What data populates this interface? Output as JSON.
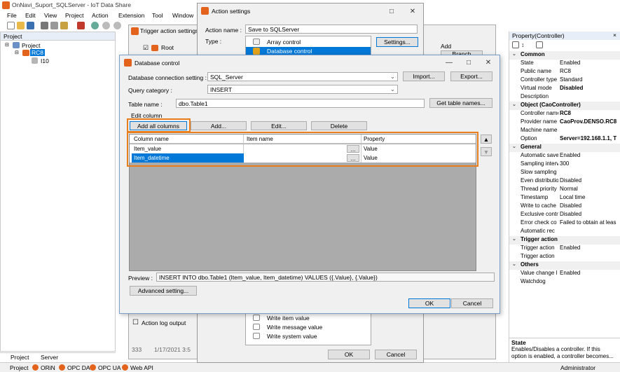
{
  "app": {
    "title": "OnNavi_Suport_SQLServer - IoT Data Share",
    "menu": [
      "File",
      "Edit",
      "View",
      "Project",
      "Action",
      "Extension",
      "Tool",
      "Window"
    ]
  },
  "project_panel": {
    "title": "Project",
    "tree": [
      "Project",
      "RC8",
      "I10"
    ]
  },
  "trigger_window": {
    "title": "Trigger action settings",
    "root_label": "Root",
    "branch_button": "Branch",
    "add_label": "Add",
    "action_log_label": "Action log output",
    "log_num": "333",
    "log_date": "1/17/2021 3:5"
  },
  "action_settings": {
    "title": "Action settings",
    "action_name_label": "Action name :",
    "action_name_value": "Save to SQLServer",
    "type_label": "Type :",
    "type_items": [
      "Array control",
      "Database control"
    ],
    "settings_button": "Settings...",
    "type_list_bottom": [
      "Write item value",
      "Write message value",
      "Write system value"
    ],
    "ok": "OK",
    "cancel": "Cancel"
  },
  "db_control": {
    "title": "Database control",
    "conn_label": "Database connection setting :",
    "conn_value": "SQL_Server",
    "import": "Import...",
    "export": "Export...",
    "query_label": "Query category :",
    "query_value": "INSERT",
    "table_label": "Table name :",
    "table_value": "dbo.Table1",
    "get_tables": "Get table names...",
    "edit_column": "Edit column",
    "add_all": "Add all columns",
    "add": "Add...",
    "edit": "Edit...",
    "delete": "Delete",
    "columns": [
      "Column name",
      "Item name",
      "Property"
    ],
    "rows": [
      {
        "col": "Item_value",
        "item": "",
        "browse": "...",
        "prop": "Value"
      },
      {
        "col": "Item_datetime",
        "item": "",
        "browse": "...",
        "prop": "Value"
      }
    ],
    "preview_label": "Preview :",
    "preview_value": "INSERT INTO dbo.Table1 (Item_value, Item_datetime) VALUES ({.Value}, {.Value})",
    "advanced": "Advanced setting...",
    "ok": "OK",
    "cancel": "Cancel"
  },
  "properties": {
    "title": "Property(Controller)",
    "categories": [
      {
        "name": "Common",
        "rows": [
          [
            "State",
            "Enabled"
          ],
          [
            "Public name",
            "RC8"
          ],
          [
            "Controller type",
            "Standard"
          ],
          [
            "Virtual mode",
            "Disabled"
          ],
          [
            "Description",
            ""
          ]
        ]
      },
      {
        "name": "Object (CaoController)",
        "rows": [
          [
            "Controller name",
            "RC8"
          ],
          [
            "Provider name",
            "CaoProv.DENSO.RC8"
          ],
          [
            "Machine name",
            ""
          ],
          [
            "Option",
            "Server=192.168.1.1, T"
          ]
        ]
      },
      {
        "name": "General",
        "rows": [
          [
            "Automatic save",
            "Enabled"
          ],
          [
            "Sampling interval",
            "300"
          ],
          [
            "Slow sampling",
            ""
          ],
          [
            "Even distribution",
            "Disabled"
          ],
          [
            "Thread priority",
            "Normal"
          ],
          [
            "Timestamp",
            "Local time"
          ],
          [
            "Write to cache",
            "Disabled"
          ],
          [
            "Exclusive control",
            "Disabled"
          ],
          [
            "Error check co",
            "Failed to obtain at leas"
          ],
          [
            "Automatic rec",
            ""
          ]
        ]
      },
      {
        "name": "Trigger action",
        "rows": [
          [
            "Trigger action",
            "Enabled"
          ],
          [
            "Trigger action",
            ""
          ]
        ]
      },
      {
        "name": "Others",
        "rows": [
          [
            "Value change l",
            "Enabled"
          ],
          [
            "Watchdog",
            ""
          ]
        ]
      }
    ],
    "desc_title": "State",
    "desc_text": "Enables/Disables a controller. If this option is enabled, a controller becomes..."
  },
  "bottom_tabs": [
    "Project",
    "Server"
  ],
  "status": [
    "Project",
    "ORiN",
    "OPC DA",
    "OPC UA",
    "Web API"
  ],
  "status_user": "Administrator",
  "colors": {
    "accent": "#0078d7",
    "highlight": "#e87d1e",
    "grid_bg": "#ababab",
    "orange_icon": "#e3631c"
  }
}
